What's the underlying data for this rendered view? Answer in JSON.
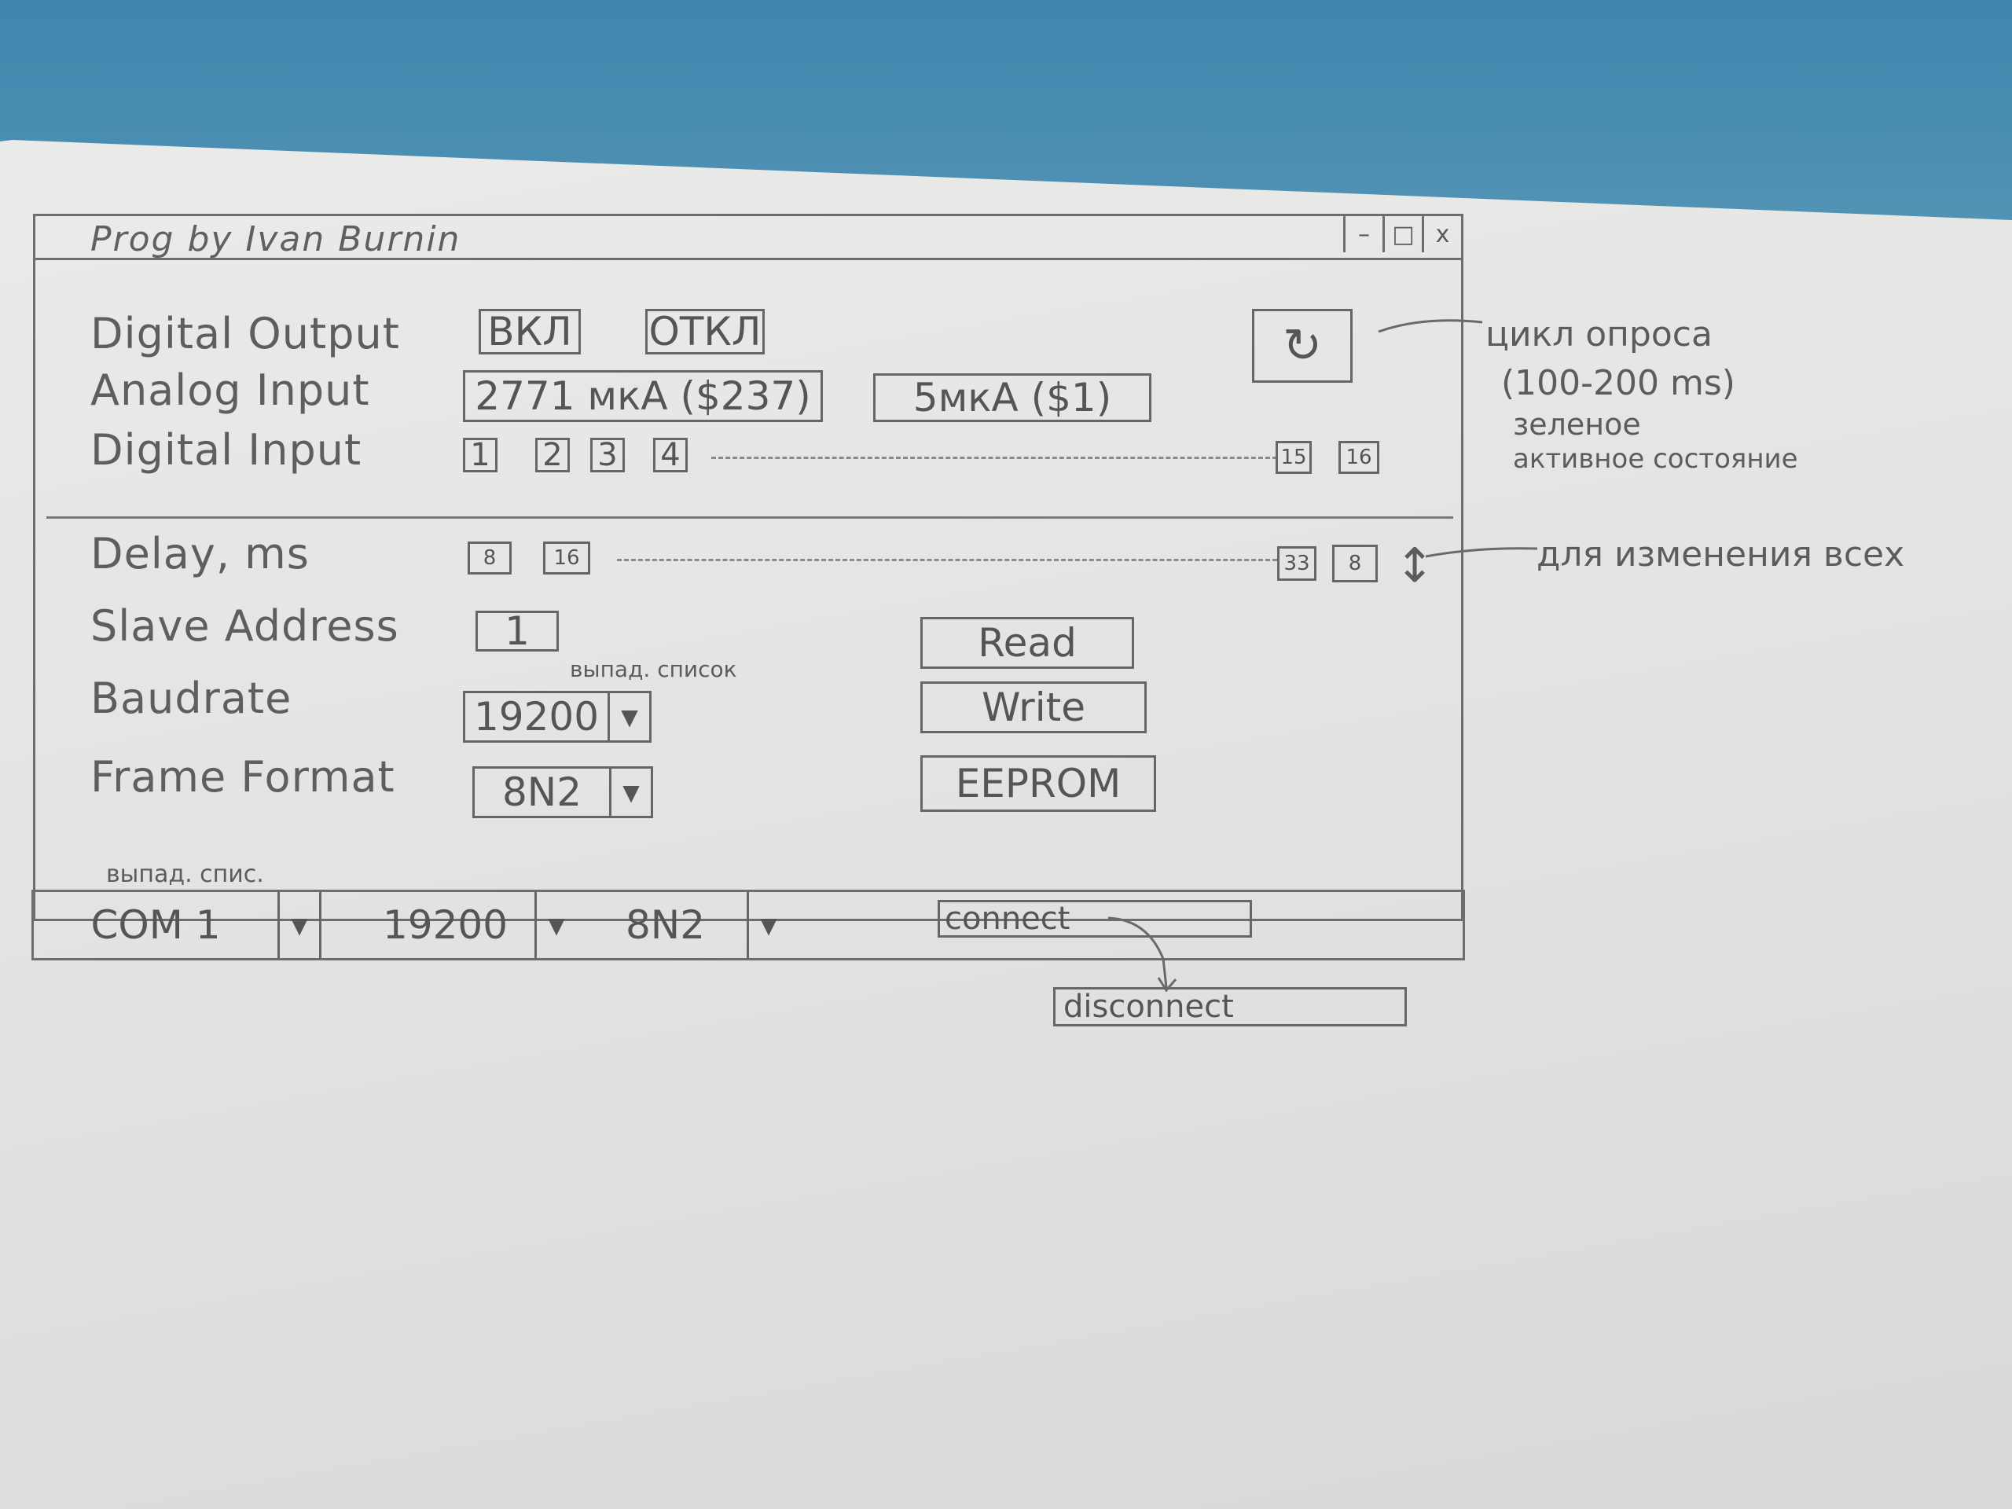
{
  "window": {
    "title": "Prog by Ivan Burnin",
    "minimize": "–",
    "maximize": "□",
    "close": "x"
  },
  "digital_output": {
    "label": "Digital Output",
    "on_button": "ВКЛ",
    "off_button": "ОТКЛ"
  },
  "refresh_icon": "↻",
  "analog_input": {
    "label": "Analog Input",
    "field1": "2771 мкА ($237)",
    "field2": "5мкА ($1)"
  },
  "digital_input": {
    "label": "Digital Input",
    "boxes_start": [
      "1",
      "2",
      "3",
      "4"
    ],
    "boxes_end": [
      "15",
      "16"
    ]
  },
  "delay": {
    "label": "Delay, ms",
    "boxes_start": [
      "8",
      "16"
    ],
    "boxes_end": [
      "33",
      "8"
    ],
    "spin_icon": "↕"
  },
  "slave_address": {
    "label": "Slave Address",
    "value": "1"
  },
  "baudrate": {
    "label": "Baudrate",
    "value": "19200",
    "note": "выпад. список"
  },
  "frame_format": {
    "label": "Frame Format",
    "value": "8N2"
  },
  "actions": {
    "read": "Read",
    "write": "Write",
    "eeprom": "EEPROM"
  },
  "statusbar": {
    "note": "выпад. спис.",
    "port": "COM 1",
    "baud": "19200",
    "format": "8N2",
    "connect": "connect",
    "disconnect": "disconnect"
  },
  "annotations": {
    "poll_line1": "цикл опроса",
    "poll_line2": "(100-200 ms)",
    "poll_line3": "зеленое",
    "poll_line4": "активное состояние",
    "delay_note": "для изменения всех"
  }
}
